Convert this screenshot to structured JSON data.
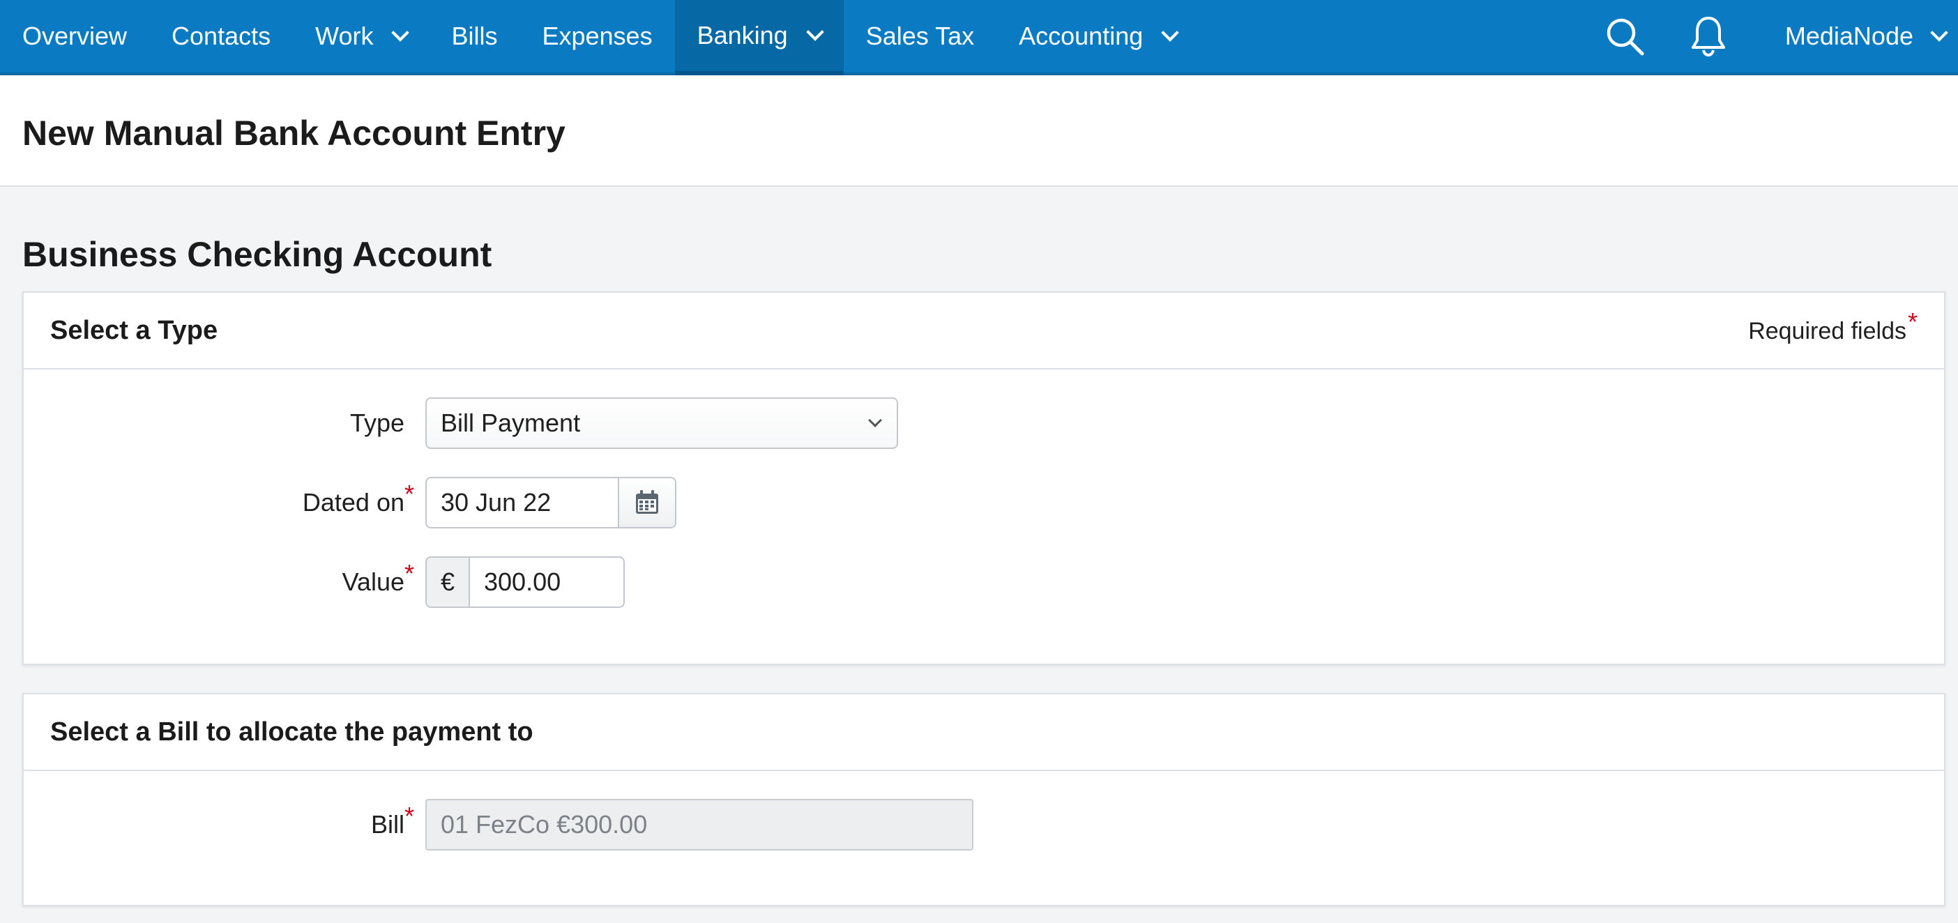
{
  "nav": {
    "items": [
      {
        "label": "Overview",
        "has_dropdown": false,
        "active": false
      },
      {
        "label": "Contacts",
        "has_dropdown": false,
        "active": false
      },
      {
        "label": "Work",
        "has_dropdown": true,
        "active": false
      },
      {
        "label": "Bills",
        "has_dropdown": false,
        "active": false
      },
      {
        "label": "Expenses",
        "has_dropdown": false,
        "active": false
      },
      {
        "label": "Banking",
        "has_dropdown": true,
        "active": true
      },
      {
        "label": "Sales Tax",
        "has_dropdown": false,
        "active": false
      },
      {
        "label": "Accounting",
        "has_dropdown": true,
        "active": true
      }
    ],
    "account_name": "MediaNode",
    "icons": [
      "search-icon",
      "bell-icon"
    ]
  },
  "page": {
    "title": "New Manual Bank Account Entry",
    "account_name": "Business Checking Account"
  },
  "type_card": {
    "title": "Select a Type",
    "required_note": "Required fields",
    "required_marker": "*",
    "type_label": "Type",
    "type_value": "Bill Payment",
    "dated_label": "Dated on",
    "dated_value": "30 Jun 22",
    "value_label": "Value",
    "currency_symbol": "€",
    "value_amount": "300.00"
  },
  "bill_card": {
    "title": "Select a Bill to allocate the payment to",
    "bill_label": "Bill",
    "bill_value": "01 FezCo €300.00"
  },
  "colors": {
    "nav_bg": "#0a7bc2",
    "nav_active_bg": "#0768a6",
    "required_star": "#d0021b",
    "page_bg": "#f3f4f6"
  }
}
